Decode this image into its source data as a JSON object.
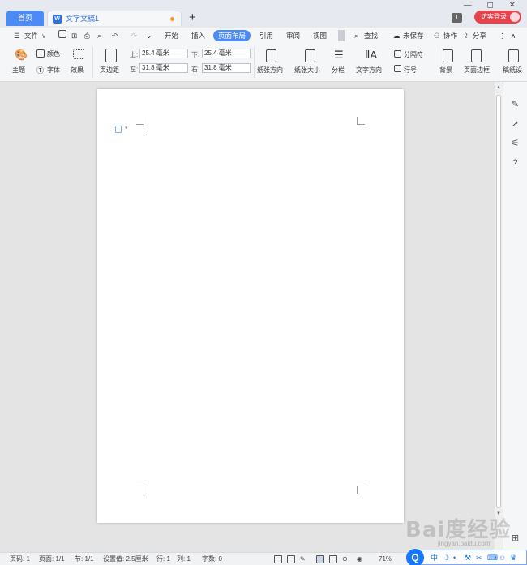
{
  "tabs": {
    "home": "首页",
    "doc_title": "文字文稿1",
    "doc_badge": "W",
    "add": "+"
  },
  "window": {
    "controls": "— ◻ ✕",
    "counter": "1",
    "login": "访客登录"
  },
  "menu": {
    "file": "文件",
    "items": [
      "开始",
      "插入",
      "页面布局",
      "引用",
      "审阅",
      "视图"
    ],
    "active": "页面布局",
    "search": "查找",
    "unsaved": "未保存",
    "collab": "协作",
    "share": "分享"
  },
  "ribbon": {
    "theme": "主题",
    "color": "颜色",
    "font": "字体",
    "effect": "效果",
    "margins": "页边距",
    "margin_top_label": "上:",
    "margin_top": "25.4 毫米",
    "margin_bottom_label": "下:",
    "margin_bottom": "25.4 毫米",
    "margin_left_label": "左:",
    "margin_left": "31.8 毫米",
    "margin_right_label": "右:",
    "margin_right": "31.8 毫米",
    "orientation": "纸张方向",
    "size": "纸张大小",
    "columns": "分栏",
    "text_direction": "文字方向",
    "breaks": "分隔符",
    "line_numbers": "行号",
    "background": "背景",
    "page_border": "页面边框",
    "manuscript": "稿纸设"
  },
  "statusbar": {
    "page_no": "页码: 1",
    "pages": "页面: 1/1",
    "section": "节: 1/1",
    "setting": "设置值: 2.5厘米",
    "row": "行: 1",
    "col": "列: 1",
    "words": "字数: 0",
    "zoom": "71%"
  },
  "watermark": {
    "text": "Bai度经验",
    "sub": "jingyan.baidu.com"
  },
  "ime": {
    "lang": "中",
    "logo": "Q"
  }
}
